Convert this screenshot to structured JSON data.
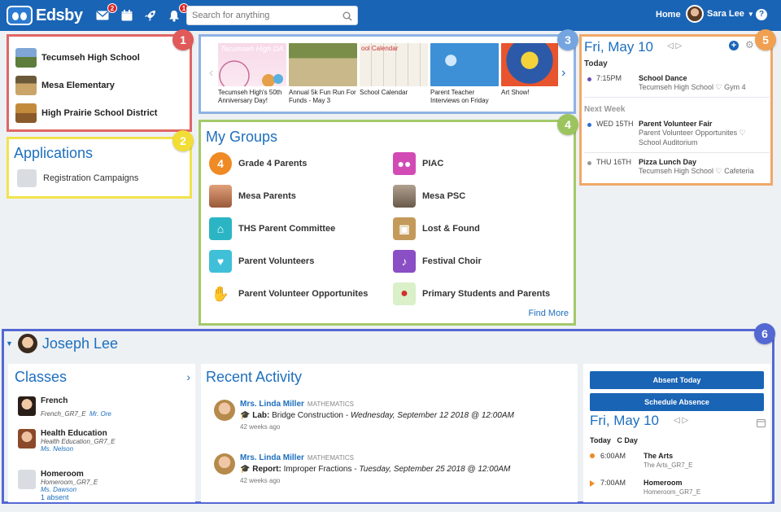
{
  "app": {
    "name": "Edsby"
  },
  "topbar": {
    "mail_badge": "2",
    "notif_badge": "1",
    "search_placeholder": "Search for anything",
    "home_label": "Home",
    "user_name": "Sara Lee",
    "help_label": "?"
  },
  "schools": [
    {
      "name": "Tecumseh High School"
    },
    {
      "name": "Mesa Elementary"
    },
    {
      "name": "High Prairie School District"
    }
  ],
  "applications": {
    "title": "Applications",
    "items": [
      {
        "label": "Registration Campaigns"
      }
    ]
  },
  "news": [
    {
      "caption": "Tecumseh High's 50th Anniversary Day!",
      "banner": "Tecumseh High DA"
    },
    {
      "caption": "Annual 5k Fun Run For Funds - May 3",
      "banner": ""
    },
    {
      "caption": "School Calendar",
      "banner": "ool Calendar"
    },
    {
      "caption": "Parent Teacher Interviews on Friday",
      "banner": ""
    },
    {
      "caption": "Art Show!",
      "banner": ""
    }
  ],
  "groups": {
    "title": "My Groups",
    "items": [
      {
        "label": "Grade 4 Parents",
        "icon": "4",
        "color": "#f08a24"
      },
      {
        "label": "PIAC",
        "icon": "people-icon",
        "color": "#d24bb5"
      },
      {
        "label": "Mesa Parents",
        "icon": "photo",
        "color": "#c9875e"
      },
      {
        "label": "Mesa PSC",
        "icon": "photo",
        "color": "#8a7a6a"
      },
      {
        "label": "THS Parent Committee",
        "icon": "building-icon",
        "color": "#2bb5c4"
      },
      {
        "label": "Lost & Found",
        "icon": "box-icon",
        "color": "#b88a4a"
      },
      {
        "label": "Parent Volunteers",
        "icon": "heart-hand-icon",
        "color": "#3fc0d8"
      },
      {
        "label": "Festival Choir",
        "icon": "music-icon",
        "color": "#8a4fc4"
      },
      {
        "label": "Parent Volunteer Opportunites",
        "icon": "hands-icon",
        "color": "#4caf50"
      },
      {
        "label": "Primary Students and Parents",
        "icon": "apple-icon",
        "color": "#d9f0c8"
      }
    ],
    "find_more": "Find More"
  },
  "calendar": {
    "date": "Fri, May 10",
    "today_label": "Today",
    "next_week_label": "Next Week",
    "events_today": [
      {
        "time": "7:15PM",
        "title": "School Dance",
        "location": "Tecumseh High School ♡ Gym 4",
        "dot": "#6a4fb5"
      }
    ],
    "events_next": [
      {
        "time": "WED 15TH",
        "title": "Parent Volunteer Fair",
        "location": "Parent Volunteer Opportunites ♡",
        "location2": "School Auditorium",
        "dot": "#2b6fd0"
      },
      {
        "time": "THU 16TH",
        "title": "Pizza Lunch Day",
        "location": "Tecumseh High School ♡ Cafeteria",
        "dot": "#999999"
      }
    ]
  },
  "callouts": [
    "1",
    "2",
    "3",
    "4",
    "5",
    "6"
  ],
  "student": {
    "name": "Joseph Lee",
    "classes_title": "Classes",
    "classes": [
      {
        "name": "French",
        "code": "French_GR7_E",
        "teacher": "Mr. Ore",
        "extra": ""
      },
      {
        "name": "Health Education",
        "code": "Health Education_GR7_E",
        "teacher": "Ms. Nelson",
        "extra": ""
      },
      {
        "name": "Homeroom",
        "code": "Homeroom_GR7_E",
        "teacher": "Ms. Dawson",
        "extra": "1 absent"
      }
    ],
    "activity_title": "Recent Activity",
    "activity": [
      {
        "teacher": "Mrs. Linda Miller",
        "subject": "MATHEMATICS",
        "kind": "Lab:",
        "title": "Bridge Construction",
        "when": " - Wednesday, September 12 2018 @ 12:00AM",
        "ago": "42 weeks ago"
      },
      {
        "teacher": "Mrs. Linda Miller",
        "subject": "MATHEMATICS",
        "kind": "Report:",
        "title": "Improper Fractions",
        "when": " - Tuesday, September 25 2018 @ 12:00AM",
        "ago": "42 weeks ago"
      }
    ],
    "absent_today": "Absent Today",
    "schedule_absence": "Schedule Absence",
    "sched_date": "Fri, May 10",
    "day_label": "Today",
    "day_code": "C Day",
    "periods": [
      {
        "time": "6:00AM",
        "name": "The Arts",
        "code": "The Arts_GR7_E",
        "color": "#f08a24"
      },
      {
        "time": "7:00AM",
        "name": "Homeroom",
        "code": "Homeroom_GR7_E",
        "color": "#f08a24"
      }
    ]
  }
}
